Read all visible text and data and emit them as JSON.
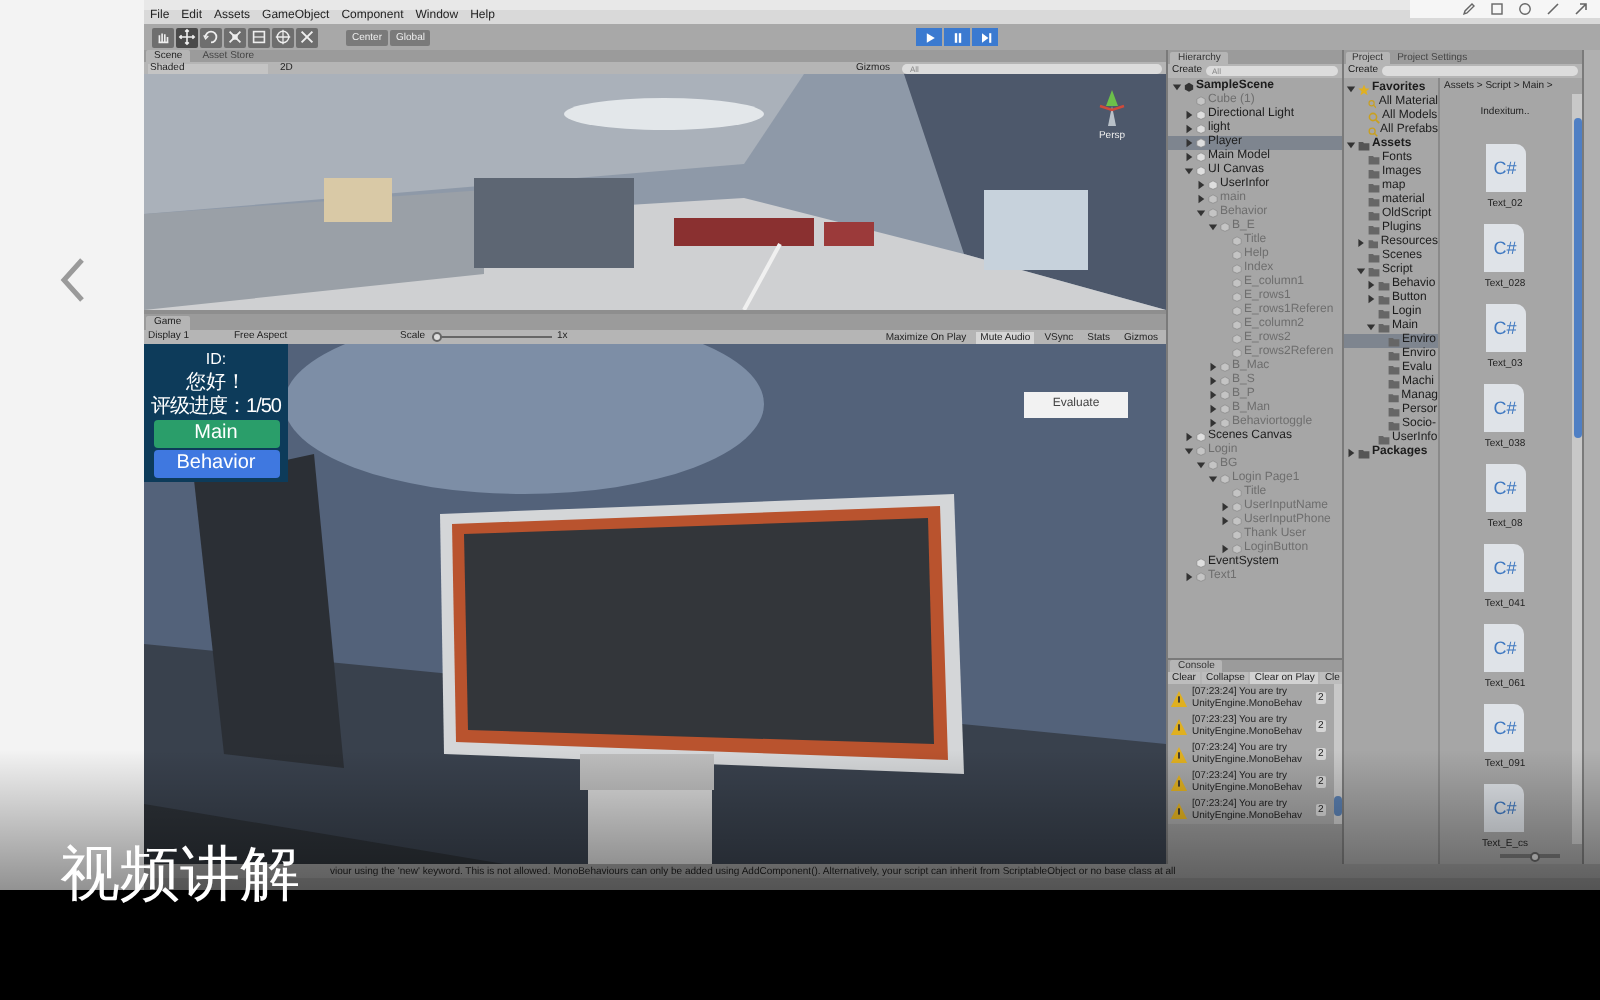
{
  "menu": [
    "File",
    "Edit",
    "Assets",
    "GameObject",
    "Component",
    "Window",
    "Help"
  ],
  "toolbar": {
    "tools": [
      {
        "kind": "hand",
        "selected": false
      },
      {
        "kind": "move",
        "selected": true
      },
      {
        "kind": "rotate",
        "selected": false
      },
      {
        "kind": "scale",
        "selected": false
      },
      {
        "kind": "rect",
        "selected": false
      },
      {
        "kind": "transform",
        "selected": false
      },
      {
        "kind": "custom",
        "selected": false
      }
    ],
    "pivot": "Center",
    "space": "Global",
    "play_controls": [
      {
        "kind": "play",
        "on": true
      },
      {
        "kind": "pause",
        "on": true
      },
      {
        "kind": "step",
        "on": true
      }
    ]
  },
  "scene_tabs": [
    {
      "label": "Scene",
      "selected": true
    },
    {
      "label": "Asset Store",
      "selected": false
    }
  ],
  "scene_toolbar": {
    "shading": "Shaded",
    "mode_2d": "2D",
    "gizmos": "Gizmos",
    "search_placeholder": "All"
  },
  "scene_view": {
    "kind": "picture",
    "camera": "Persp"
  },
  "game_tab": "Game",
  "game_toolbar": {
    "display": "Display 1",
    "aspect": "Free Aspect",
    "scale_label": "Scale",
    "scale": "1x",
    "toggles": [
      {
        "label": "Maximize On Play",
        "on": false
      },
      {
        "label": "Mute Audio",
        "on": true
      },
      {
        "label": "VSync",
        "on": false
      },
      {
        "label": "Stats",
        "on": false
      },
      {
        "label": "Gizmos",
        "on": false
      }
    ]
  },
  "game_view": {
    "kind": "picture",
    "id_label": "ID:",
    "greeting": "您好！",
    "progress": "评级进度：1/50",
    "buttons": [
      {
        "label": "Main",
        "kind": "main"
      },
      {
        "label": "Behavior",
        "kind": "behavior"
      }
    ],
    "evaluate": "Evaluate"
  },
  "hierarchy": {
    "title": "Hierarchy",
    "create": "Create",
    "search_placeholder": "All",
    "items": [
      {
        "name": "SampleScene",
        "kind": "scene",
        "expanded": true,
        "selected": false,
        "dimmed": false,
        "children": [
          {
            "name": "Cube (1)",
            "selected": false,
            "dimmed": true
          },
          {
            "name": "Directional Light",
            "expanded": false,
            "selected": false,
            "dimmed": false
          },
          {
            "name": "light",
            "expanded": false,
            "selected": false,
            "dimmed": false
          },
          {
            "name": "Player",
            "expanded": false,
            "selected": true,
            "dimmed": false
          },
          {
            "name": "Main Model",
            "expanded": false,
            "selected": false,
            "dimmed": false
          },
          {
            "name": "UI Canvas",
            "expanded": true,
            "selected": false,
            "dimmed": false,
            "children": [
              {
                "name": "UserInfor",
                "expanded": false,
                "selected": false,
                "dimmed": false
              },
              {
                "name": "main",
                "expanded": false,
                "selected": false,
                "dimmed": true
              },
              {
                "name": "Behavior",
                "expanded": true,
                "selected": false,
                "dimmed": true,
                "children": [
                  {
                    "name": "B_E",
                    "expanded": true,
                    "selected": false,
                    "dimmed": true,
                    "children": [
                      {
                        "name": "Title",
                        "selected": false,
                        "dimmed": true
                      },
                      {
                        "name": "Help",
                        "selected": false,
                        "dimmed": true
                      },
                      {
                        "name": "Index",
                        "selected": false,
                        "dimmed": true
                      },
                      {
                        "name": "E_column1",
                        "selected": false,
                        "dimmed": true
                      },
                      {
                        "name": "E_rows1",
                        "selected": false,
                        "dimmed": true
                      },
                      {
                        "name": "E_rows1Referen",
                        "selected": false,
                        "dimmed": true
                      },
                      {
                        "name": "E_column2",
                        "selected": false,
                        "dimmed": true
                      },
                      {
                        "name": "E_rows2",
                        "selected": false,
                        "dimmed": true
                      },
                      {
                        "name": "E_rows2Referen",
                        "selected": false,
                        "dimmed": true
                      }
                    ]
                  },
                  {
                    "name": "B_Mac",
                    "expanded": false,
                    "selected": false,
                    "dimmed": true
                  },
                  {
                    "name": "B_S",
                    "expanded": false,
                    "selected": false,
                    "dimmed": true
                  },
                  {
                    "name": "B_P",
                    "expanded": false,
                    "selected": false,
                    "dimmed": true
                  },
                  {
                    "name": "B_Man",
                    "expanded": false,
                    "selected": false,
                    "dimmed": true
                  },
                  {
                    "name": "Behaviortoggle",
                    "expanded": false,
                    "selected": false,
                    "dimmed": true
                  }
                ]
              }
            ]
          },
          {
            "name": "Scenes Canvas",
            "expanded": false,
            "selected": false,
            "dimmed": false
          },
          {
            "name": "Login",
            "expanded": true,
            "selected": false,
            "dimmed": true,
            "children": [
              {
                "name": "BG",
                "expanded": true,
                "selected": false,
                "dimmed": true,
                "children": [
                  {
                    "name": "Login Page1",
                    "expanded": true,
                    "selected": false,
                    "dimmed": true,
                    "children": [
                      {
                        "name": "Title",
                        "selected": false,
                        "dimmed": true
                      },
                      {
                        "name": "UserInputName",
                        "expanded": false,
                        "selected": false,
                        "dimmed": true
                      },
                      {
                        "name": "UserInputPhone",
                        "expanded": false,
                        "selected": false,
                        "dimmed": true
                      },
                      {
                        "name": "Thank User",
                        "selected": false,
                        "dimmed": true
                      },
                      {
                        "name": "LoginButton",
                        "expanded": false,
                        "selected": false,
                        "dimmed": true
                      }
                    ]
                  }
                ]
              }
            ]
          },
          {
            "name": "EventSystem",
            "selected": false,
            "dimmed": false
          },
          {
            "name": "Text1",
            "expanded": false,
            "selected": false,
            "dimmed": true
          }
        ]
      }
    ]
  },
  "project": {
    "tabs": [
      {
        "label": "Project",
        "selected": true
      },
      {
        "label": "Project Settings",
        "selected": false
      }
    ],
    "create": "Create",
    "breadcrumb": "Assets > Script > Main >",
    "tree": [
      {
        "name": "Favorites",
        "kind": "favorites",
        "expanded": true,
        "selected": false,
        "children": [
          {
            "name": "All Material",
            "kind": "search",
            "selected": false
          },
          {
            "name": "All Models",
            "kind": "search",
            "selected": false
          },
          {
            "name": "All Prefabs",
            "kind": "search",
            "selected": false
          }
        ]
      },
      {
        "name": "Assets",
        "kind": "root",
        "expanded": true,
        "selected": false,
        "children": [
          {
            "name": "Fonts",
            "kind": "folder",
            "selected": false
          },
          {
            "name": "Images",
            "kind": "folder",
            "selected": false
          },
          {
            "name": "map",
            "kind": "folder",
            "selected": false
          },
          {
            "name": "material",
            "kind": "folder",
            "selected": false
          },
          {
            "name": "OldScript",
            "kind": "folder",
            "selected": false
          },
          {
            "name": "Plugins",
            "kind": "folder",
            "selected": false
          },
          {
            "name": "Resources",
            "kind": "folder",
            "expanded": false,
            "selected": false
          },
          {
            "name": "Scenes",
            "kind": "folder",
            "selected": false
          },
          {
            "name": "Script",
            "kind": "folder",
            "expanded": true,
            "selected": false,
            "children": [
              {
                "name": "Behavio",
                "kind": "folder",
                "expanded": false,
                "selected": false
              },
              {
                "name": "Button",
                "kind": "folder",
                "expanded": false,
                "selected": false
              },
              {
                "name": "Login",
                "kind": "folder",
                "selected": false
              },
              {
                "name": "Main",
                "kind": "folder",
                "expanded": true,
                "selected": false,
                "children": [
                  {
                    "name": "Enviro",
                    "kind": "folder",
                    "selected": true
                  },
                  {
                    "name": "Enviro",
                    "kind": "folder",
                    "selected": false
                  },
                  {
                    "name": "Evalu",
                    "kind": "folder",
                    "selected": false
                  },
                  {
                    "name": "Machi",
                    "kind": "folder",
                    "selected": false
                  },
                  {
                    "name": "Manag",
                    "kind": "folder",
                    "selected": false
                  },
                  {
                    "name": "Persor",
                    "kind": "folder",
                    "selected": false
                  },
                  {
                    "name": "Socio-",
                    "kind": "folder",
                    "selected": false
                  }
                ]
              },
              {
                "name": "UserInfo",
                "kind": "folder",
                "selected": false
              }
            ]
          }
        ]
      },
      {
        "name": "Packages",
        "kind": "root",
        "expanded": false,
        "selected": false
      }
    ],
    "files": [
      {
        "name": "Indexitum..",
        "kind": "label"
      },
      {
        "name": "Text_02",
        "kind": "script",
        "badge": "C#"
      },
      {
        "name": "Text_028",
        "kind": "script",
        "badge": "C#"
      },
      {
        "name": "Text_03",
        "kind": "script",
        "badge": "C#"
      },
      {
        "name": "Text_038",
        "kind": "script",
        "badge": "C#"
      },
      {
        "name": "Text_08",
        "kind": "script",
        "badge": "C#"
      },
      {
        "name": "Text_041",
        "kind": "script",
        "badge": "C#"
      },
      {
        "name": "Text_061",
        "kind": "script",
        "badge": "C#"
      },
      {
        "name": "Text_091",
        "kind": "script",
        "badge": "C#"
      },
      {
        "name": "Text_E_cs",
        "kind": "script",
        "badge": "C#"
      }
    ],
    "zoom_slider": {
      "level": 0.6
    }
  },
  "console": {
    "title": "Console",
    "buttons": [
      {
        "label": "Clear",
        "on": false
      },
      {
        "label": "Collapse",
        "on": false
      },
      {
        "label": "Clear on Play",
        "on": true
      },
      {
        "label": "Cle",
        "on": false
      }
    ],
    "entries": [
      {
        "message": "[07:23:24] You are try",
        "source": "UnityEngine.MonoBehav",
        "count": "2"
      },
      {
        "message": "[07:23:23] You are try",
        "source": "UnityEngine.MonoBehav",
        "count": "2"
      },
      {
        "message": "[07:23:24] You are try",
        "source": "UnityEngine.MonoBehav",
        "count": "2"
      },
      {
        "message": "[07:23:24] You are try",
        "source": "UnityEngine.MonoBehav",
        "count": "2"
      },
      {
        "message": "[07:23:24] You are try",
        "source": "UnityEngine.MonoBehav",
        "count": "2"
      }
    ]
  },
  "status_bar": "viour using the 'new' keyword.  This is not allowed.  MonoBehaviours can only be added using AddComponent(). Alternatively, your script can inherit from ScriptableObject or no base class at all",
  "caption": "视频讲解"
}
